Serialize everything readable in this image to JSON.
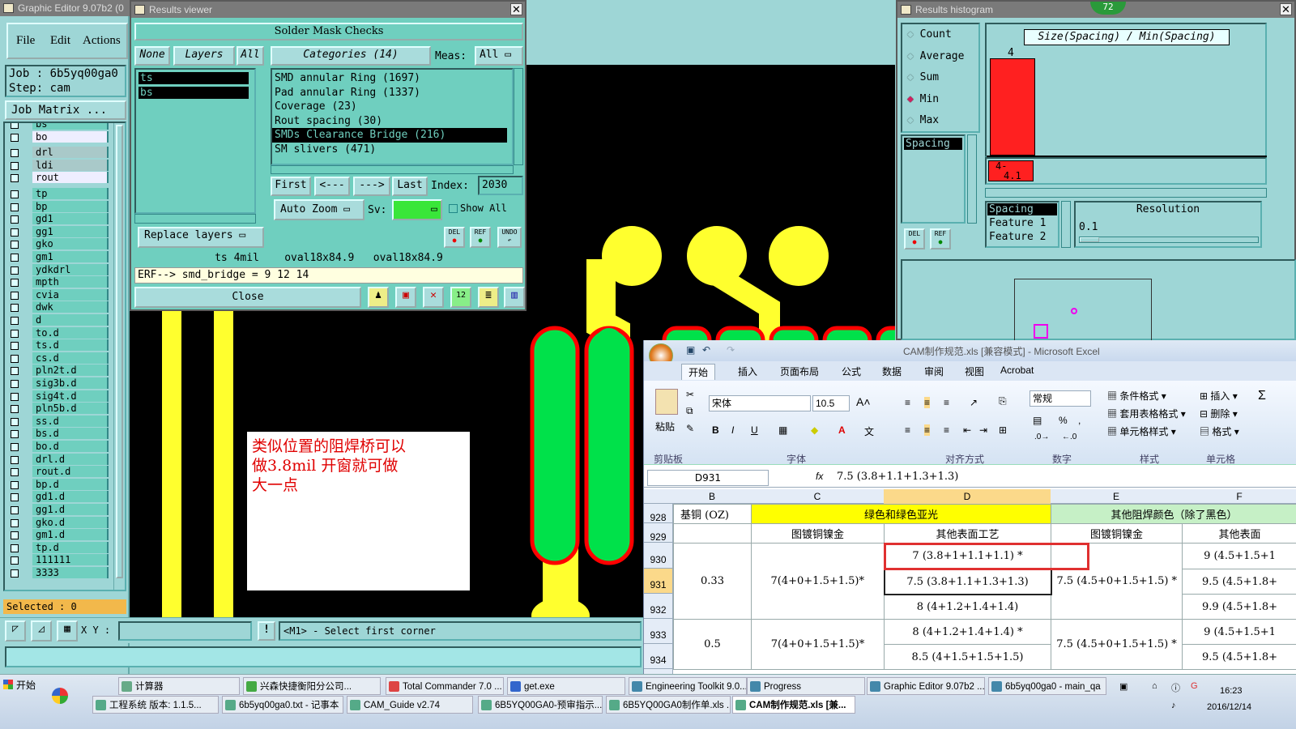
{
  "graphic_editor": {
    "title": "Graphic Editor 9.07b2 (0",
    "menu": [
      "File",
      "Edit",
      "Actions"
    ],
    "job_label": "Job : 6b5yq00ga0",
    "step_label": "Step: cam",
    "job_matrix": "Job Matrix ...",
    "layers": [
      "bs",
      "bo",
      "drl",
      "ldi",
      "rout",
      "tp",
      "bp",
      "gd1",
      "gg1",
      "gko",
      "gm1",
      "ydkdrl",
      "mpth",
      "cvia",
      "dwk",
      "d",
      "to.d",
      "ts.d",
      "cs.d",
      "pln2t.d",
      "sig3b.d",
      "sig4t.d",
      "pln5b.d",
      "ss.d",
      "bs.d",
      "bo.d",
      "drl.d",
      "rout.d",
      "bp.d",
      "gd1.d",
      "gg1.d",
      "gko.d",
      "gm1.d",
      "tp.d",
      "111111",
      "3333"
    ],
    "selected": "Selected : 0",
    "xy_label": "X Y :",
    "status": "<M1> - Select first corner",
    "annotation": [
      "类似位置的阻焊桥可以",
      "做3.8mil  开窗就可做",
      "大一点"
    ]
  },
  "results_viewer": {
    "title": "Results viewer",
    "header": "Solder Mask Checks",
    "none_btn": "None",
    "layers_btn": "Layers",
    "all_btn": "All",
    "categories_btn": "Categories (14)",
    "meas_label": "Meas:",
    "meas_value": "All",
    "layer_list": [
      "ts",
      "bs"
    ],
    "categories": [
      "SMD annular Ring (1697)",
      "Pad annular Ring (1337)",
      "Coverage (23)",
      "Rout spacing (30)",
      "SMDs Clearance Bridge (216)",
      "SM slivers (471)"
    ],
    "selected_category": 4,
    "first": "First",
    "prev": "<---",
    "next": "--->",
    "last": "Last",
    "index_label": "Index:",
    "index_value": "2030",
    "auto_zoom": "Auto Zoom",
    "sv_label": "Sv:",
    "show_all": "Show All",
    "replace_layers": "Replace layers",
    "del": "DEL",
    "ref": "REF",
    "undo": "UNDO",
    "measure_line": "ts 4mil    oval18x84.9   oval18x84.9",
    "erf_line": "ERF--> smd_bridge = 9 12 14",
    "close": "Close"
  },
  "histogram": {
    "title": "Results histogram",
    "badge": "72",
    "options": [
      "Count",
      "Average",
      "Sum",
      "Min",
      "Max"
    ],
    "selected_option": "Min",
    "metric": "Size(Spacing) / Min(Spacing)",
    "bar_label": "4",
    "bar2_label1": "4-",
    "bar2_label2": "4.1",
    "spacing_item": "Spacing",
    "del": "DEL",
    "ref": "REF",
    "list2": [
      "Spacing",
      "Feature 1",
      "Feature 2"
    ],
    "resolution_label": "Resolution",
    "resolution_value": "0.1"
  },
  "excel": {
    "title": "CAM制作规范.xls  [兼容模式] - Microsoft Excel",
    "tabs": [
      "开始",
      "插入",
      "页面布局",
      "公式",
      "数据",
      "审阅",
      "视图",
      "Acrobat"
    ],
    "paste": "粘贴",
    "clipboard": "剪贴板",
    "font_name": "宋体",
    "font_size": "10.5",
    "font_group": "字体",
    "align_group": "对齐方式",
    "number_format": "常规",
    "number_group": "数字",
    "cond_format": "条件格式",
    "table_format": "套用表格格式",
    "cell_style": "单元格样式",
    "style_group": "样式",
    "insert": "插入",
    "delete": "删除",
    "format": "格式",
    "cells_group": "单元格",
    "cell_ref": "D931",
    "fx": "fx",
    "formula": "7.5 (3.8+1.1+1.3+1.3)",
    "columns": [
      "B",
      "C",
      "D",
      "E",
      "F"
    ],
    "rows": [
      "928",
      "929",
      "930",
      "931",
      "932",
      "933",
      "934"
    ],
    "r928_b": "基铜 (OZ)",
    "r928_cd": "绿色和绿色亚光",
    "r928_ef": "其他阻焊颜色（除了黑色）",
    "r929_c": "图镀铜镍金",
    "r929_d": "其他表面工艺",
    "r929_e": "图镀铜镍金",
    "r929_f": "其他表面",
    "g1_b": "0.33",
    "g1_c": "7(4+0+1.5+1.5)*",
    "g1_d": [
      "7 (3.8+1+1.1+1.1) *",
      "7.5 (3.8+1.1+1.3+1.3)",
      "8 (4+1.2+1.4+1.4)"
    ],
    "g1_e": "7.5 (4.5+0+1.5+1.5) *",
    "g1_f": [
      "9 (4.5+1.5+1",
      "9.5 (4.5+1.8+",
      "9.9 (4.5+1.8+"
    ],
    "g2_b": "0.5",
    "g2_c": "7(4+0+1.5+1.5)*",
    "g2_d": [
      "8 (4+1.2+1.4+1.4) *",
      "8.5 (4+1.5+1.5+1.5)"
    ],
    "g2_e": "7.5 (4.5+0+1.5+1.5) *",
    "g2_f": [
      "9 (4.5+1.5+1",
      "9.5 (4.5+1.8+"
    ]
  },
  "taskbar": {
    "start": "开始",
    "row1": [
      "计算器",
      "兴森快捷衡阳分公司...",
      "Total Commander 7.0 ...",
      "get.exe",
      "Engineering Toolkit 9.0...",
      "Progress",
      "Graphic Editor 9.07b2 ...",
      "6b5yq00ga0 - main_qa"
    ],
    "row2": [
      "工程系统  版本: 1.1.5...",
      "6b5yq00ga0.txt - 记事本",
      "CAM_Guide v2.74",
      "6B5YQ00GA0-预审指示...",
      "6B5YQ00GA0制作单.xls ...",
      "CAM制作规范.xls [兼..."
    ],
    "time": "16:23",
    "date": "2016/12/14"
  }
}
